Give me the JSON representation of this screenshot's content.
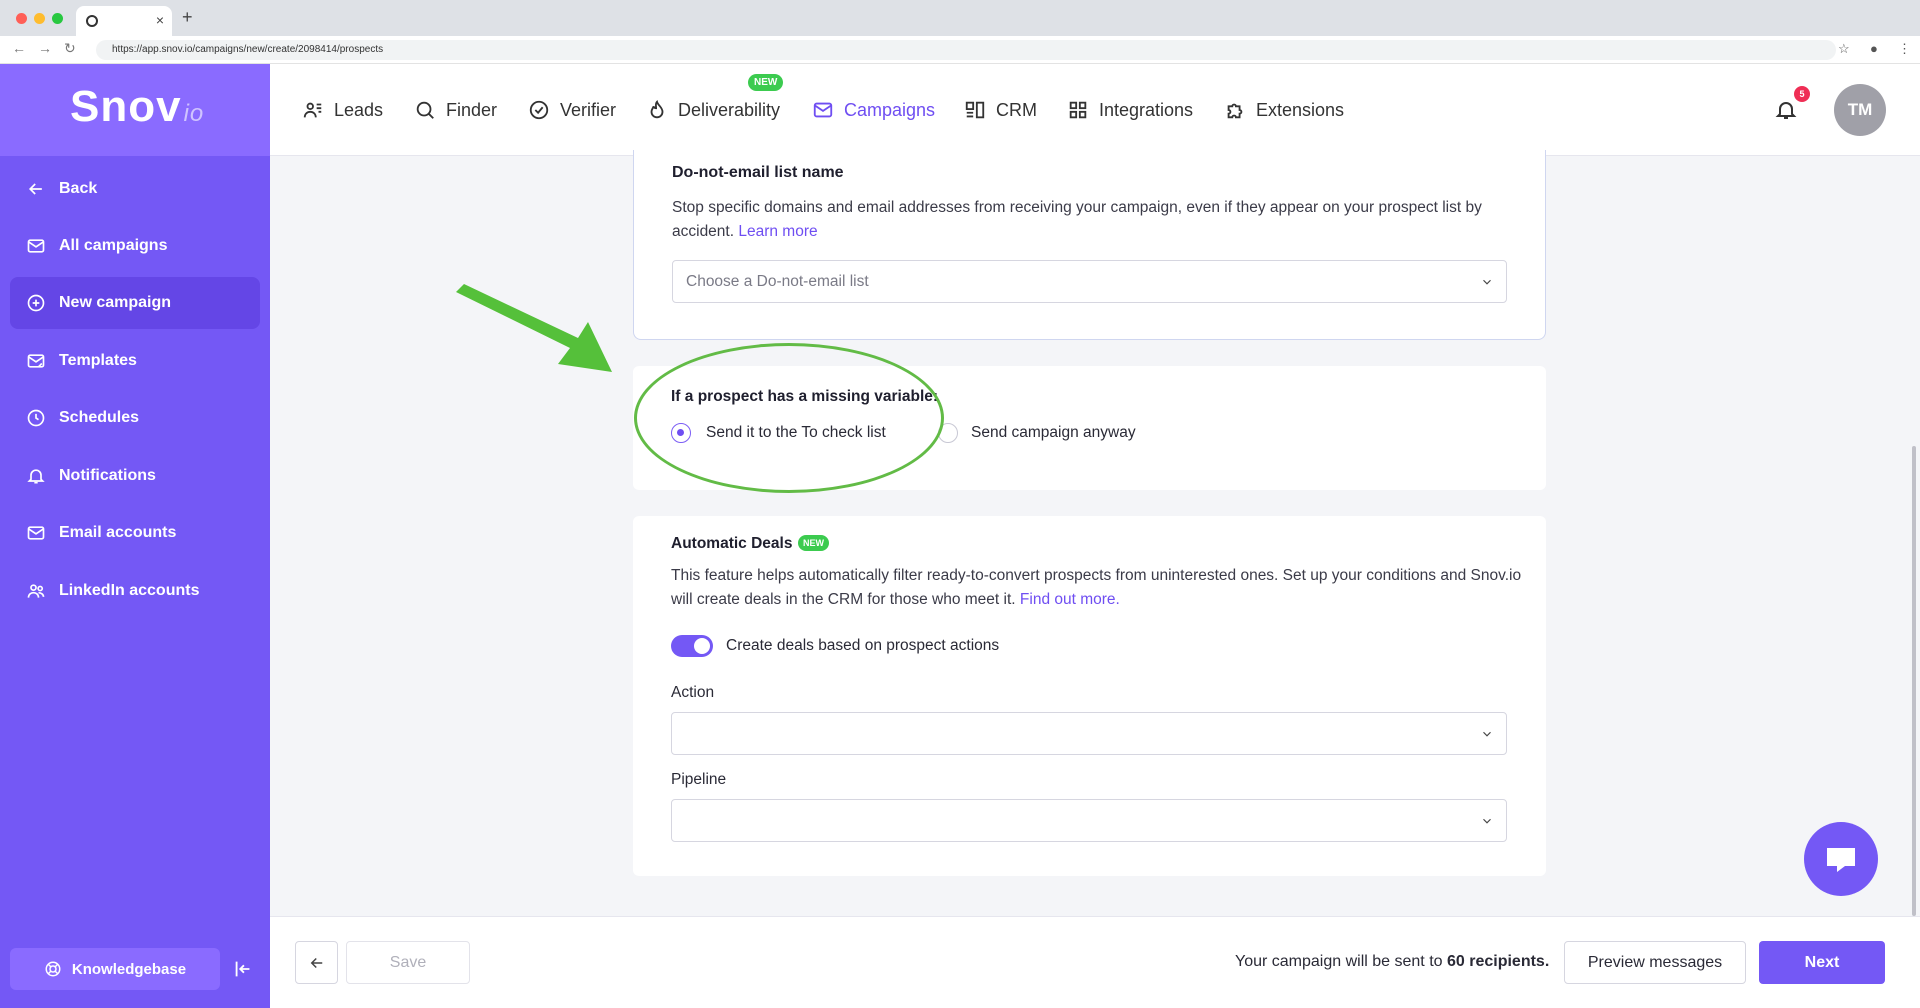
{
  "browser": {
    "tab_close": "×",
    "new_tab": "+",
    "url": "https://app.snov.io/campaigns/new/create/2098414/prospects"
  },
  "sidebar": {
    "logo": "Snov",
    "logo_suffix": "io",
    "items": [
      {
        "label": "Back",
        "icon": "arrow-left-icon"
      },
      {
        "label": "All campaigns",
        "icon": "mail-icon"
      },
      {
        "label": "New campaign",
        "icon": "plus-circle-icon",
        "active": true
      },
      {
        "label": "Templates",
        "icon": "mail-template-icon"
      },
      {
        "label": "Schedules",
        "icon": "clock-icon"
      },
      {
        "label": "Notifications",
        "icon": "bell-icon"
      },
      {
        "label": "Email accounts",
        "icon": "mail-icon"
      },
      {
        "label": "LinkedIn accounts",
        "icon": "users-icon"
      }
    ],
    "knowledgebase": "Knowledgebase"
  },
  "topnav": {
    "items": [
      {
        "label": "Leads",
        "icon": "users-icon"
      },
      {
        "label": "Finder",
        "icon": "search-icon"
      },
      {
        "label": "Verifier",
        "icon": "check-circle-icon"
      },
      {
        "label": "Deliverability",
        "icon": "flame-icon"
      },
      {
        "label": "Campaigns",
        "icon": "mail-icon",
        "active": true
      },
      {
        "label": "CRM",
        "icon": "crm-icon"
      },
      {
        "label": "Integrations",
        "icon": "grid-icon"
      },
      {
        "label": "Extensions",
        "icon": "puzzle-icon"
      }
    ],
    "new_badge": "NEW",
    "notification_count": "5",
    "avatar_initials": "TM"
  },
  "dne": {
    "title": "Do-not-email list name",
    "description": "Stop specific domains and email addresses from receiving your campaign, even if they appear on your prospect list by accident.",
    "link": "Learn more",
    "placeholder": "Choose a Do-not-email list"
  },
  "missing_var": {
    "title": "If a prospect has a missing variable:",
    "option1": "Send it to the To check list",
    "option2": "Send campaign anyway",
    "selected": "option1"
  },
  "deals": {
    "title": "Automatic Deals",
    "badge": "NEW",
    "description": "This feature helps automatically filter ready-to-convert prospects from uninterested ones. Set up your conditions and Snov.io will create deals in the CRM for those who meet it.",
    "link": "Find out more.",
    "toggle_label": "Create deals based on prospect actions",
    "toggle_on": true,
    "action_label": "Action",
    "pipeline_label": "Pipeline"
  },
  "footer": {
    "save": "Save",
    "recipients_prefix": "Your campaign will be sent to",
    "recipients_count": "60 recipients.",
    "preview": "Preview messages",
    "next": "Next"
  },
  "colors": {
    "accent": "#7458f5",
    "annotation": "#62bb46",
    "badge_green": "#3ccb4f"
  }
}
